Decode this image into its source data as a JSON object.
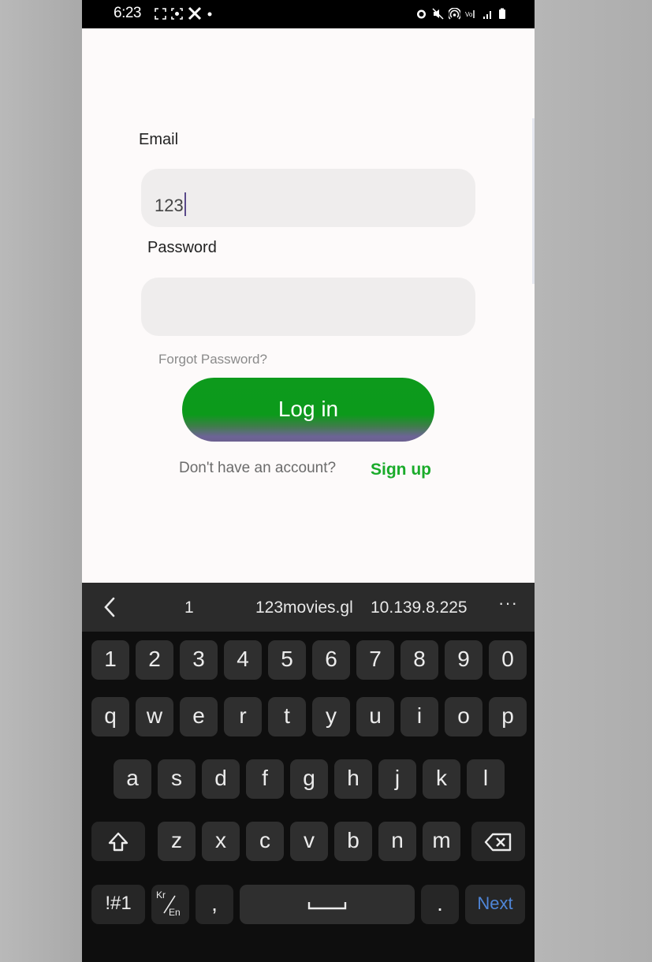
{
  "status_bar": {
    "time": "6:23",
    "left_icons": [
      "screenshot-icon",
      "screen-record-icon",
      "x-app-icon",
      "dot-icon"
    ],
    "right_icons": [
      "alarm-icon",
      "mute-icon",
      "hotspot-icon",
      "volte-icon",
      "signal-icon",
      "battery-icon"
    ]
  },
  "form": {
    "email_label": "Email",
    "email_value": "123",
    "password_label": "Password",
    "password_value": "",
    "forgot_password": "Forgot Password?",
    "login_button": "Log in",
    "signup_prompt": "Don't have an account?",
    "signup_link": "Sign up",
    "colors": {
      "accent_green": "#0d9a1c",
      "link_green": "#1aab2a"
    }
  },
  "keyboard": {
    "suggestions": [
      "1",
      "123movies.gl",
      "10.139.8.225"
    ],
    "more": "···",
    "row_numbers": [
      "1",
      "2",
      "3",
      "4",
      "5",
      "6",
      "7",
      "8",
      "9",
      "0"
    ],
    "row_1": [
      "q",
      "w",
      "e",
      "r",
      "t",
      "y",
      "u",
      "i",
      "o",
      "p"
    ],
    "row_2": [
      "a",
      "s",
      "d",
      "f",
      "g",
      "h",
      "j",
      "k",
      "l"
    ],
    "row_3": [
      "z",
      "x",
      "c",
      "v",
      "b",
      "n",
      "m"
    ],
    "symbols_key": "!#1",
    "lang_key_top": "Kr",
    "lang_key_bottom": "En",
    "comma": ",",
    "period": ".",
    "next_key": "Next",
    "next_color": "#4f86d8"
  }
}
